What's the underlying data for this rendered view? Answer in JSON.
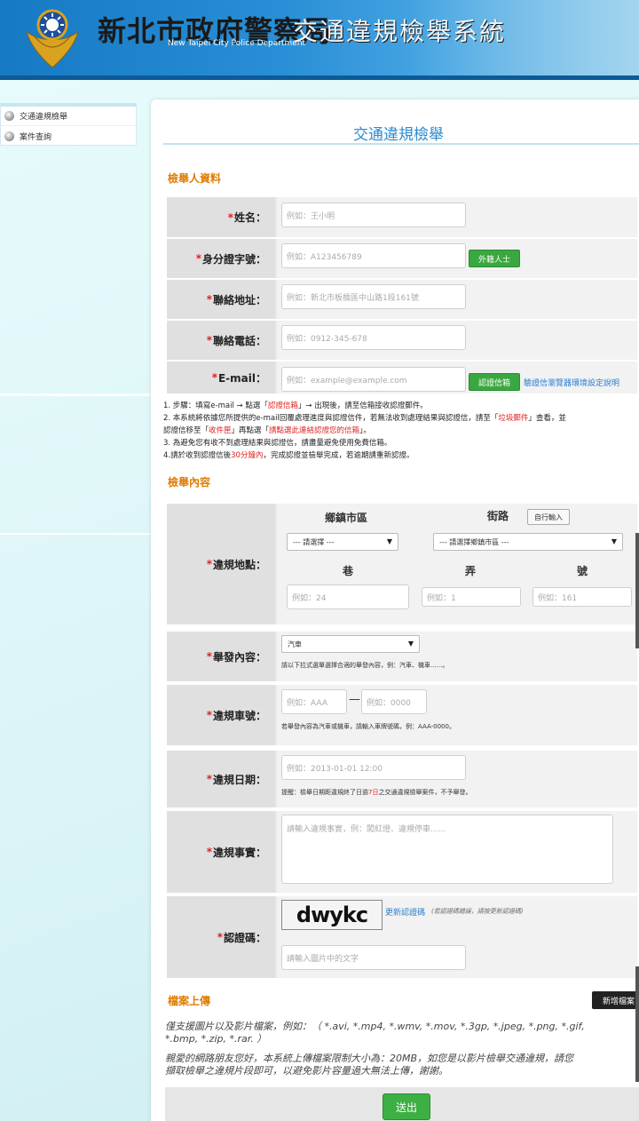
{
  "header": {
    "title_main": "新北市政府警察局",
    "title_sub": "交通違規檢舉系統",
    "title_en": "New Taipei City Police Department"
  },
  "sidebar": {
    "items": [
      {
        "label": "交通違規檢舉"
      },
      {
        "label": "案件查詢"
      }
    ]
  },
  "page": {
    "title": "交通違規檢舉"
  },
  "reporter": {
    "section_title": "檢舉人資料",
    "name": {
      "label": "姓名：",
      "placeholder": "例如：王小明"
    },
    "id": {
      "label": "身分證字號：",
      "placeholder": "例如：A123456789",
      "button": "外籍人士"
    },
    "address": {
      "label": "聯絡地址：",
      "placeholder": "例如：新北市板橋區中山路1段161號"
    },
    "phone": {
      "label": "聯絡電話：",
      "placeholder": "例如：0912-345-678"
    },
    "email": {
      "label": "E-mail：",
      "placeholder": "例如：example@example.com",
      "button": "認證信箱",
      "link": "驗證信瀏覽器環境設定說明"
    }
  },
  "notes": {
    "n1_a": "1. 步驟：填寫e-mail → 點選「",
    "n1_b": "認證信箱",
    "n1_c": "」→ 出現後，請至信箱接收認證郵件。",
    "n2_a": "2. 本系統將依據您所提供的e-mail回覆處理進度與認證信件，若無法收到處理結果與認證信，請至「",
    "n2_b": "垃圾郵件",
    "n2_c": "」查看，並",
    "n2_d": "認證信移至「",
    "n2_e": "收件匣",
    "n2_f": "」再點選「",
    "n2_g": "請點選此連結認證您的信箱",
    "n2_h": "」。",
    "n3": "3. 為避免您有收不到處理結果與認證信，請盡量避免使用免費信箱。",
    "n4_a": "4.請於收到認證信後",
    "n4_b": "30分鐘內",
    "n4_c": "，完成認證並檢舉完成，若逾期請重新認證。"
  },
  "content": {
    "section_title": "檢舉內容",
    "location": {
      "label": "違規地點：",
      "district_header": "鄉鎮市區",
      "street_header": "街路",
      "manual_button": "自行輸入",
      "district_select": "--- 請選擇 ---",
      "street_select": "--- 請選擇鄉鎮市區 ---",
      "lane_header": "巷",
      "alley_header": "弄",
      "number_header": "號",
      "lane_placeholder": "例如：24",
      "alley_placeholder": "例如：1",
      "number_placeholder": "例如：161"
    },
    "type": {
      "label": "舉發內容：",
      "selected": "汽車",
      "hint": "請以下拉式選單選擇合適的舉發內容，例：汽車、機車......。"
    },
    "plate": {
      "label": "違規車號：",
      "placeholder1": "例如：AAA",
      "dash": "—",
      "placeholder2": "例如：0000",
      "hint": "若舉發內容為汽車或機車，請輸入車牌號碼，例：AAA-0000。"
    },
    "date": {
      "label": "違規日期：",
      "placeholder": "例如：2013-01-01 12:00",
      "hint_a": "提醒：檢舉日期距違規終了日逾",
      "hint_b": "7日",
      "hint_c": "之交通違規檢舉案件，不予舉發。"
    },
    "facts": {
      "label": "違規事實：",
      "placeholder": "請輸入違規事實，例：闖紅燈、違規停車......"
    },
    "captcha": {
      "label": "認證碼：",
      "image_text": "dwykc",
      "refresh_link": "更新認證碼",
      "refresh_note": "(若認證碼錯誤，請按更新認證碼)",
      "placeholder": "請輸入圖片中的文字"
    }
  },
  "upload": {
    "section_title": "檔案上傳",
    "add_button": "新增檔案",
    "support_line1": "僅支援圖片以及影片檔案，例如：（ *.avi, *.mp4, *.wmv, *.mov, *.3gp, *.jpeg, *.png, *.gif,",
    "support_line2": "*.bmp, *.zip, *.rar. ）",
    "notice_line1": "親愛的網路朋友您好，本系統上傳檔案限制大小為：20MB，如您是以影片檢舉交通違規，請您",
    "notice_line2": "擷取檢舉之違規片段即可，以避免影片容量過大無法上傳，謝謝。"
  },
  "submit": {
    "label": "送出"
  },
  "colors": {
    "accent": "#2a8bd0",
    "section": "#e07b00",
    "required": "#e02020",
    "button_green": "#3aa840"
  }
}
